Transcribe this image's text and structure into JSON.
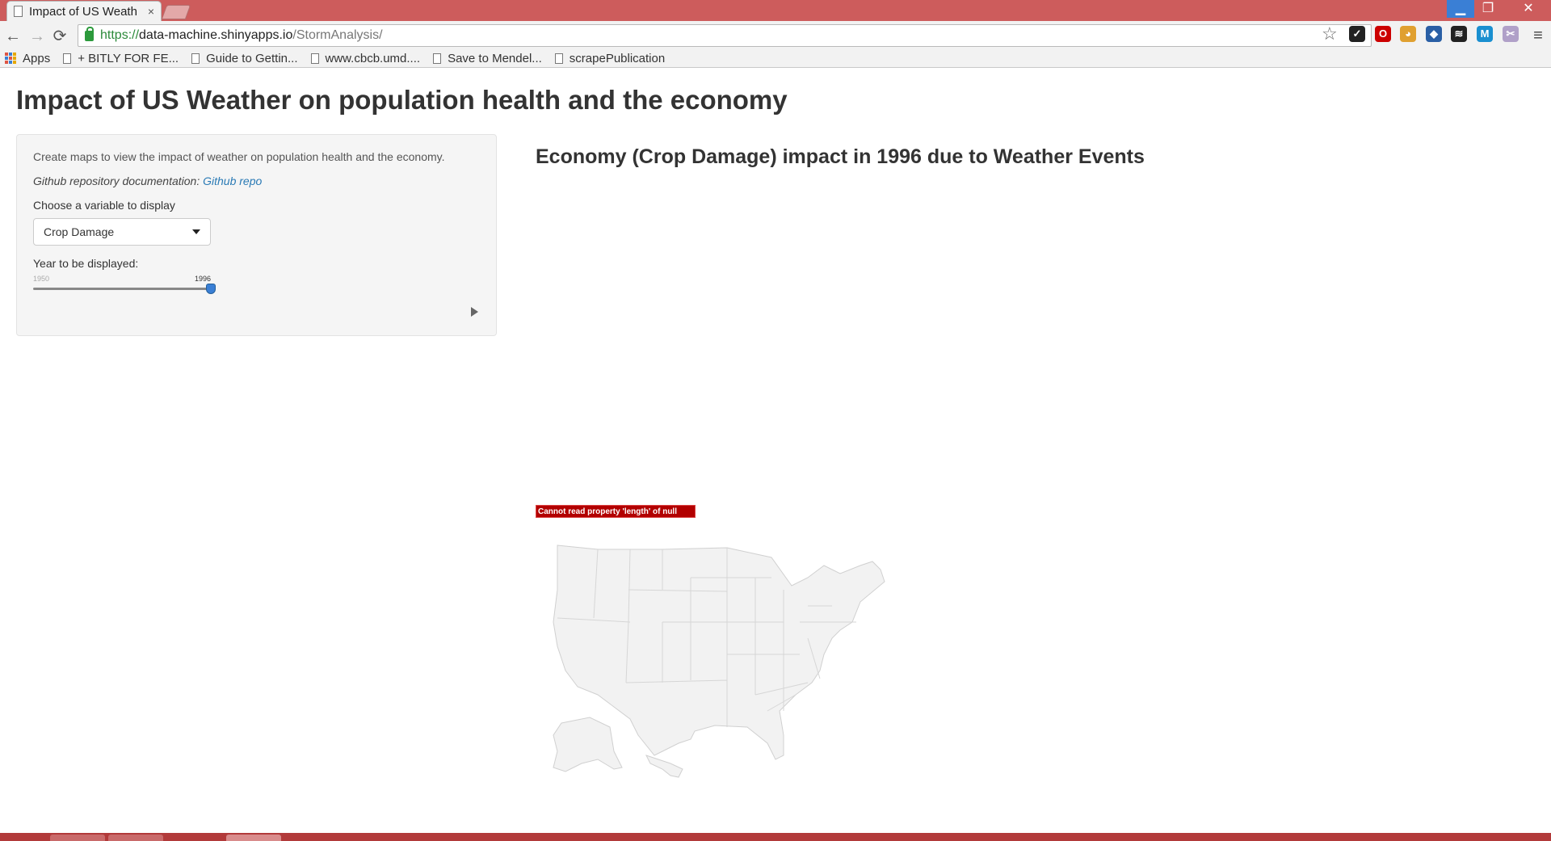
{
  "browser": {
    "tab_title": "Impact of US Weath",
    "tab_close": "×",
    "url_scheme": "https://",
    "url_host": "data-machine.shinyapps.io",
    "url_path": "/StormAnalysis/",
    "nav": {
      "back": "←",
      "forward": "→",
      "reload": "⟳"
    },
    "window_controls": {
      "minimize": "▁",
      "maximize": "❐",
      "close": "✕"
    },
    "menu_icon": "≡",
    "star_icon": "☆",
    "extensions": [
      {
        "name": "norton-icon",
        "glyph": "✓",
        "color": "#222222"
      },
      {
        "name": "opera-icon",
        "glyph": "O",
        "color": "#cc0000"
      },
      {
        "name": "cookie-icon",
        "glyph": "◕",
        "color": "#e0a030"
      },
      {
        "name": "extension-icon",
        "glyph": "◆",
        "color": "#2a5fa5"
      },
      {
        "name": "buffer-icon",
        "glyph": "≋",
        "color": "#222222"
      },
      {
        "name": "mendeley-icon",
        "glyph": "M",
        "color": "#1a8fd0"
      },
      {
        "name": "clip-icon",
        "glyph": "✂",
        "color": "#b0a0c8"
      }
    ]
  },
  "bookmarks": [
    {
      "label": "Apps",
      "icon": "apps-icon"
    },
    {
      "label": "+ BITLY FOR FE...",
      "icon": "doc-icon"
    },
    {
      "label": "Guide to Gettin...",
      "icon": "doc-icon"
    },
    {
      "label": "www.cbcb.umd....",
      "icon": "doc-icon"
    },
    {
      "label": "Save to Mendel...",
      "icon": "doc-icon"
    },
    {
      "label": "scrapePublication",
      "icon": "doc-icon"
    }
  ],
  "page": {
    "title": "Impact of US Weather on population health and the economy",
    "sidebar": {
      "description": "Create maps to view the impact of weather on population health and the economy.",
      "repo_label": "Github repository documentation: ",
      "repo_link": "Github repo",
      "variable_label": "Choose a variable to display",
      "variable_selected": "Crop Damage",
      "year_label": "Year to be displayed:",
      "year_min": "1950",
      "year_current": "1996"
    },
    "main": {
      "heading": "Economy (Crop Damage) impact in 1996 due to Weather Events",
      "error": "Cannot read property 'length' of null"
    }
  }
}
